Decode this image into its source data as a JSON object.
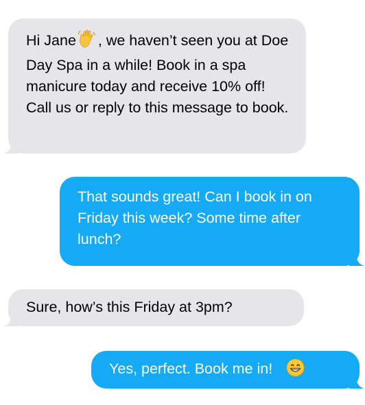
{
  "conversation": {
    "messages": [
      {
        "direction": "incoming",
        "text_before_emoji": "Hi Jane",
        "emoji": "waving-hand-icon",
        "text_after_emoji": ", we haven’t seen you at Doe Day Spa in a while! Book in a spa manicure today and receive 10% off! Call us or reply to this message to book."
      },
      {
        "direction": "outgoing",
        "text": "That sounds great! Can I book in on Friday this week? Some time after lunch?"
      },
      {
        "direction": "incoming",
        "text": "Sure, how’s this Friday at 3pm?"
      },
      {
        "direction": "outgoing",
        "text": "Yes, perfect. Book me in!",
        "emoji": "grinning-face-icon"
      }
    ]
  },
  "colors": {
    "incoming_bubble": "#e5e5ea",
    "outgoing_bubble": "#14aaf5",
    "incoming_text": "#000000",
    "outgoing_text": "#ffffff"
  }
}
